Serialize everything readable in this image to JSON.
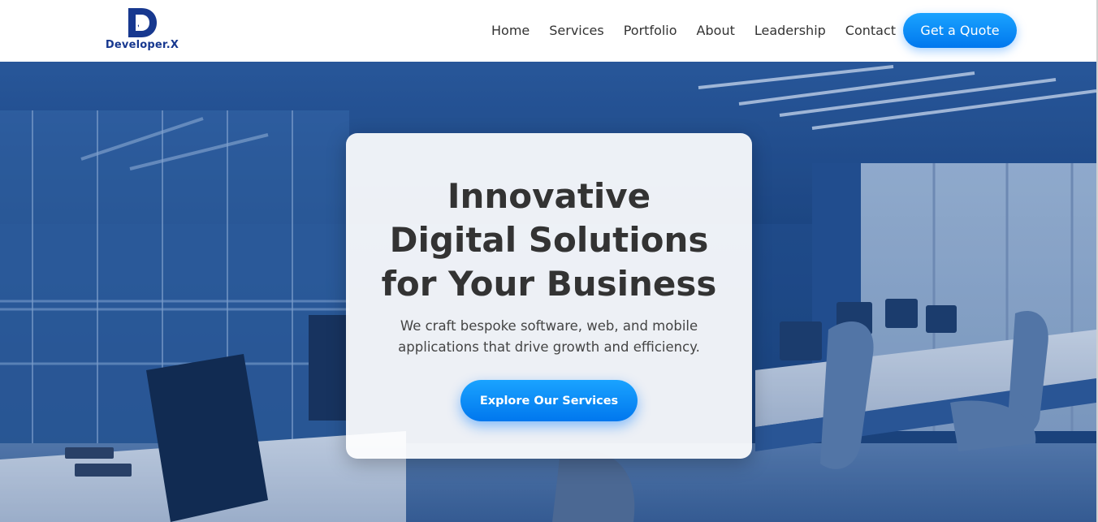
{
  "brand": {
    "name": "Developer.X",
    "color": "#17388f"
  },
  "nav": {
    "items": [
      {
        "label": "Home"
      },
      {
        "label": "Services"
      },
      {
        "label": "Portfolio"
      },
      {
        "label": "About"
      },
      {
        "label": "Leadership"
      },
      {
        "label": "Contact"
      }
    ],
    "cta_label": "Get a Quote"
  },
  "hero": {
    "title": "Innovative Digital Solutions for Your Business",
    "subtitle": "We craft bespoke software, web, and mobile applications that drive growth and efficiency.",
    "button_label": "Explore Our Services",
    "background_image": "office-interior-photo"
  },
  "colors": {
    "accent": "#0a8cff",
    "hero_tint": "#1f4a86",
    "text": "#333333"
  }
}
